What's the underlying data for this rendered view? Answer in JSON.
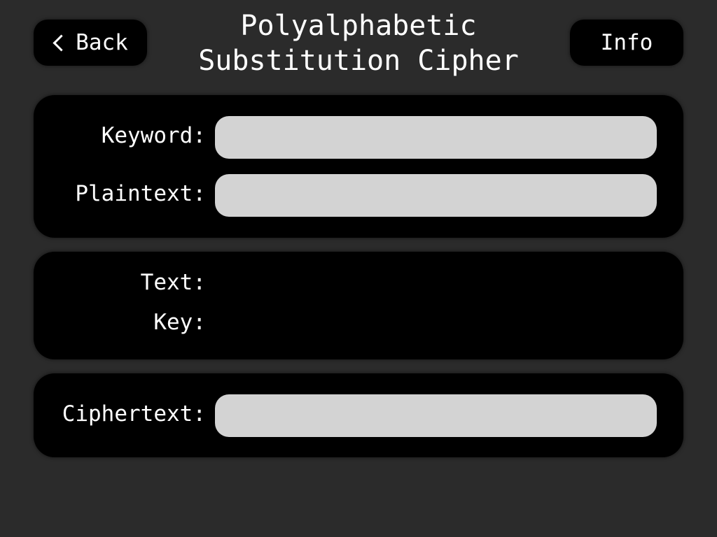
{
  "header": {
    "back_label": "Back",
    "info_label": "Info",
    "title_line1": "Polyalphabetic",
    "title_line2": "Substitution Cipher"
  },
  "input_panel": {
    "keyword_label": "Keyword:",
    "keyword_value": "",
    "plaintext_label": "Plaintext:",
    "plaintext_value": ""
  },
  "mapping_panel": {
    "text_label": "Text:",
    "text_value": "",
    "key_label": "Key:",
    "key_value": ""
  },
  "output_panel": {
    "ciphertext_label": "Ciphertext:",
    "ciphertext_value": ""
  },
  "icons": {
    "back": "chevron-left-icon"
  },
  "colors": {
    "background": "#2b2b2b",
    "panel": "#000000",
    "field": "#d3d3d3",
    "text": "#ffffff"
  }
}
